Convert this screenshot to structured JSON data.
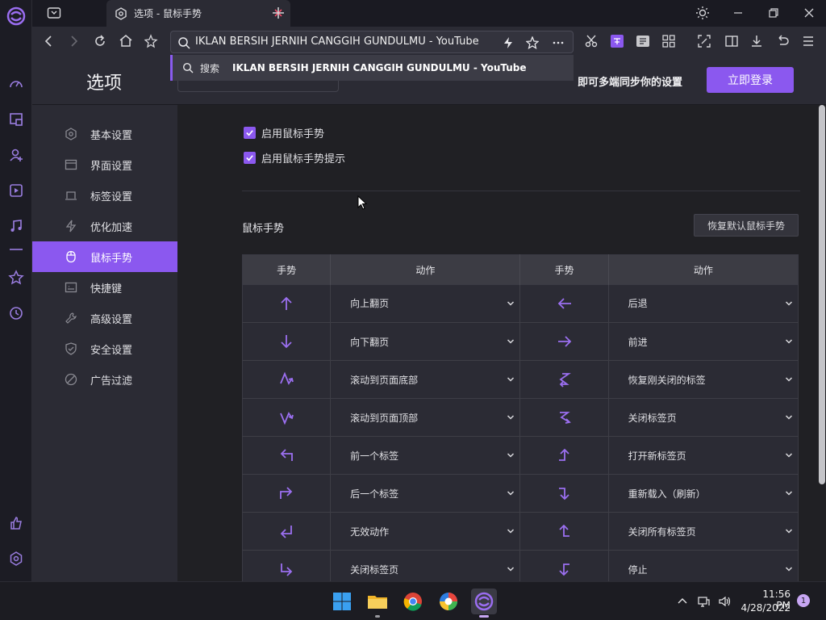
{
  "browser": {
    "tab_title": "选项 - 鼠标手势",
    "address_value": "IKLAN BERSIH JERNIH CANGGIH GUNDULMU - YouTube",
    "suggestion": {
      "label": "搜索",
      "text": "IKLAN BERSIH JERNIH CANGGIH GUNDULMU - YouTube"
    }
  },
  "header": {
    "title": "选项",
    "sync_text": "即可多端同步你的设置",
    "login_label": "立即登录"
  },
  "sidebar": {
    "items": [
      {
        "label": "基本设置",
        "icon": "gear-icon"
      },
      {
        "label": "界面设置",
        "icon": "window-icon"
      },
      {
        "label": "标签设置",
        "icon": "tab-icon"
      },
      {
        "label": "优化加速",
        "icon": "bolt-icon"
      },
      {
        "label": "鼠标手势",
        "icon": "mouse-icon",
        "active": true
      },
      {
        "label": "快捷键",
        "icon": "keyboard-icon"
      },
      {
        "label": "高级设置",
        "icon": "wrench-icon"
      },
      {
        "label": "安全设置",
        "icon": "shield-icon"
      },
      {
        "label": "广告过滤",
        "icon": "block-icon"
      }
    ]
  },
  "settings": {
    "enable_gesture": {
      "label": "启用鼠标手势",
      "checked": true
    },
    "enable_gesture_hint": {
      "label": "启用鼠标手势提示",
      "checked": true
    },
    "section_title": "鼠标手势",
    "restore_label": "恢复默认鼠标手势"
  },
  "gesture_table": {
    "headers": [
      "手势",
      "动作",
      "手势",
      "动作"
    ],
    "rows": [
      {
        "g1": "up-arrow",
        "a1": "向上翻页",
        "g2": "left-arrow",
        "a2": "后退"
      },
      {
        "g1": "down-arrow",
        "a1": "向下翻页",
        "g2": "right-arrow",
        "a2": "前进"
      },
      {
        "g1": "down-up-down-arrow",
        "a1": "滚动到页面底部",
        "g2": "zigzag-left-arrow",
        "a2": "恢复刚关闭的标签"
      },
      {
        "g1": "up-down-up-arrow",
        "a1": "滚动到页面顶部",
        "g2": "zigzag-down-arrow",
        "a2": "关闭标签页"
      },
      {
        "g1": "up-left-arrow",
        "a1": "前一个标签",
        "g2": "right-up-arrow",
        "a2": "打开新标签页"
      },
      {
        "g1": "up-right-arrow",
        "a1": "后一个标签",
        "g2": "right-down-arrow",
        "a2": "重新载入（刷新）"
      },
      {
        "g1": "right-left-arrow",
        "a1": "无效动作",
        "g2": "left-up-arrow",
        "a2": "关闭所有标签页"
      },
      {
        "g1": "down-right-arrow",
        "a1": "关闭标签页",
        "g2": "left-down-arrow",
        "a2": "停止"
      }
    ]
  },
  "taskbar": {
    "time": "11:56 PM",
    "date": "4/28/2022",
    "notification_count": "1"
  },
  "colors": {
    "accent": "#8b58ef",
    "background": "#202024",
    "panel": "#2b2b34"
  }
}
